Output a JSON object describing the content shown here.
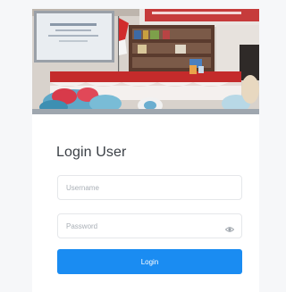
{
  "login": {
    "title": "Login User",
    "username": {
      "placeholder": "Username",
      "value": ""
    },
    "password": {
      "placeholder": "Password",
      "value": ""
    },
    "submit_label": "Login"
  },
  "hero": {
    "icon": "banner-photo"
  },
  "icons": {
    "password_toggle": "eye-icon"
  },
  "colors": {
    "primary": "#1a8cf2",
    "page_background": "#f6f7f9",
    "card_background": "#ffffff",
    "title_text": "#3a3f45",
    "placeholder_text": "#a9afb6"
  }
}
